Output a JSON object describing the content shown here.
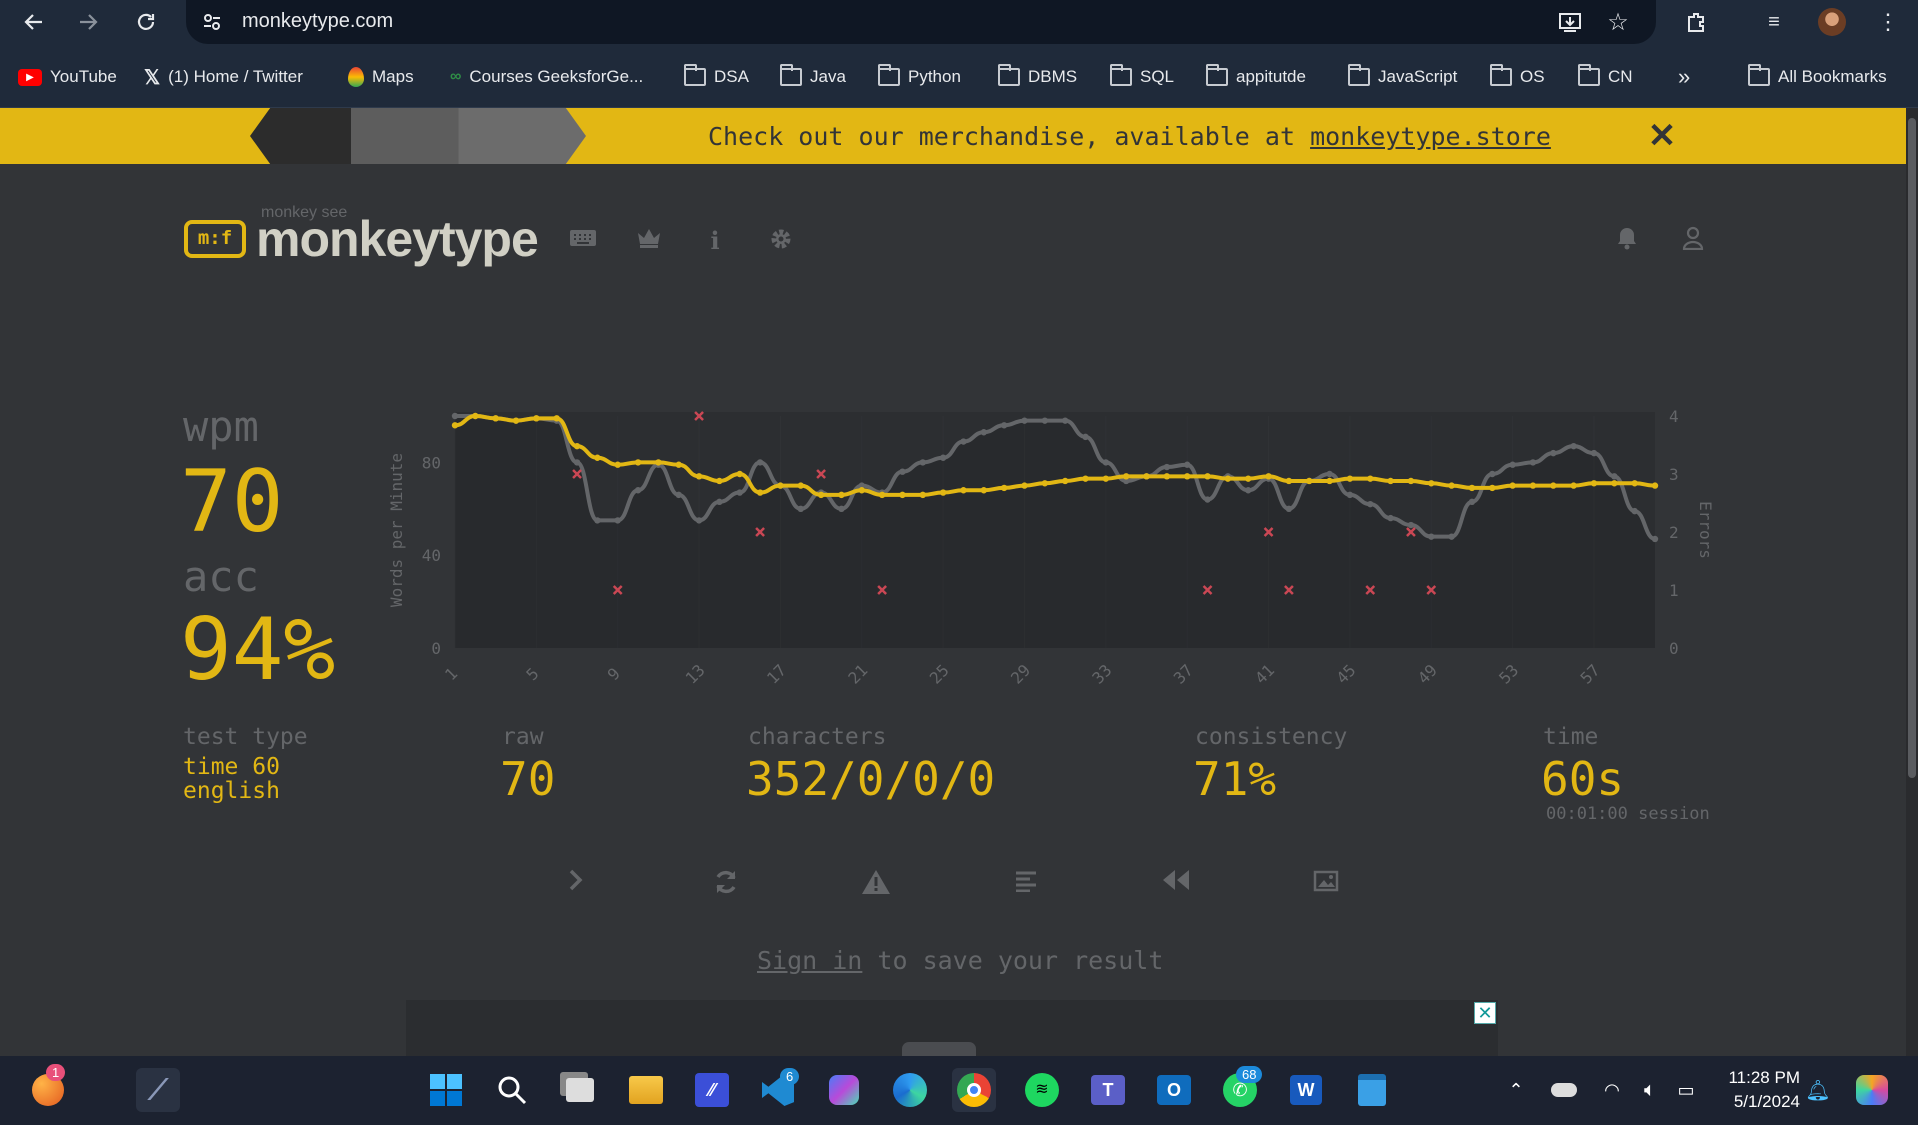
{
  "browser": {
    "url": "monkeytype.com",
    "bookmarks": [
      {
        "label": "YouTube",
        "icon": "youtube-icon"
      },
      {
        "label": "(1) Home / Twitter",
        "icon": "x-icon"
      },
      {
        "label": "Maps",
        "icon": "maps-icon"
      },
      {
        "label": "Courses GeeksforGe...",
        "icon": "geeksforgeeks-icon"
      },
      {
        "label": "DSA",
        "icon": "folder-icon"
      },
      {
        "label": "Java",
        "icon": "folder-icon"
      },
      {
        "label": "Python",
        "icon": "folder-icon"
      },
      {
        "label": "DBMS",
        "icon": "folder-icon"
      },
      {
        "label": "SQL",
        "icon": "folder-icon"
      },
      {
        "label": "appitutde",
        "icon": "folder-icon"
      },
      {
        "label": "JavaScript",
        "icon": "folder-icon"
      },
      {
        "label": "OS",
        "icon": "folder-icon"
      },
      {
        "label": "CN",
        "icon": "folder-icon"
      }
    ],
    "all_bookmarks": "All Bookmarks",
    "more_glyph": "»"
  },
  "banner": {
    "text": "Check out our merchandise, available at ",
    "link": "monkeytype.store",
    "close": "✕"
  },
  "header": {
    "logo_small": "monkey see",
    "logo": "monkeytype",
    "logo_icon_text": "m:f"
  },
  "results": {
    "wpm_label": "wpm",
    "wpm": "70",
    "acc_label": "acc",
    "acc": "94%",
    "test_type_label": "test type",
    "test_type_1": "time 60",
    "test_type_2": "english",
    "raw_label": "raw",
    "raw": "70",
    "characters_label": "characters",
    "characters": "352/0/0/0",
    "consistency_label": "consistency",
    "consistency": "71%",
    "time_label": "time",
    "time": "60s",
    "session": "00:01:00 session"
  },
  "footer": {
    "signin_link": "Sign in",
    "signin_rest": " to save your result"
  },
  "taskbar": {
    "time": "11:28 PM",
    "date": "5/1/2024",
    "badges": {
      "edge_notif": "1",
      "vscode": "6",
      "whatsapp": "68"
    }
  },
  "colors": {
    "accent": "#e2b714",
    "bg": "#323437",
    "sub": "#646669",
    "raw_line": "#646669",
    "error": "#ca4754"
  },
  "chart_data": {
    "type": "line",
    "ylabel": "Words per Minute",
    "y2label": "Errors",
    "ylim": [
      0,
      100
    ],
    "y2lim": [
      0,
      4
    ],
    "yticks": [
      "0",
      "40",
      "80"
    ],
    "y2ticks": [
      "0",
      "1",
      "2",
      "3",
      "4"
    ],
    "xticks": [
      "1",
      "5",
      "9",
      "13",
      "17",
      "21",
      "25",
      "29",
      "33",
      "37",
      "41",
      "45",
      "49",
      "53",
      "57"
    ],
    "x": [
      1,
      2,
      3,
      4,
      5,
      6,
      7,
      8,
      9,
      10,
      11,
      12,
      13,
      14,
      15,
      16,
      17,
      18,
      19,
      20,
      21,
      22,
      23,
      24,
      25,
      26,
      27,
      28,
      29,
      30,
      31,
      32,
      33,
      34,
      35,
      36,
      37,
      38,
      39,
      40,
      41,
      42,
      43,
      44,
      45,
      46,
      47,
      48,
      49,
      50,
      51,
      52,
      53,
      54,
      55,
      56,
      57,
      58,
      59,
      60
    ],
    "series": [
      {
        "values": [
          96,
          100,
          99,
          98,
          99,
          99,
          87,
          82,
          79,
          80,
          80,
          79,
          74,
          72,
          75,
          67,
          70,
          70,
          66,
          66,
          68,
          66,
          66,
          66,
          67,
          68,
          68,
          69,
          70,
          71,
          72,
          73,
          73,
          74,
          74,
          74,
          74,
          74,
          73,
          73,
          74,
          72,
          72,
          72,
          73,
          73,
          72,
          72,
          71,
          70,
          69,
          69,
          70,
          70,
          70,
          70,
          71,
          71,
          71,
          70
        ]
      },
      {
        "values": [
          100,
          100,
          99,
          98,
          99,
          98,
          80,
          55,
          55,
          68,
          79,
          66,
          55,
          63,
          67,
          80,
          70,
          60,
          67,
          60,
          70,
          67,
          76,
          80,
          82,
          89,
          93,
          96,
          98,
          98,
          98,
          91,
          80,
          72,
          74,
          78,
          79,
          64,
          74,
          68,
          73,
          60,
          72,
          75,
          66,
          62,
          56,
          53,
          48,
          48,
          63,
          75,
          79,
          80,
          84,
          87,
          84,
          74,
          59,
          47
        ]
      }
    ],
    "errors": [
      {
        "x": 7,
        "y": 3
      },
      {
        "x": 9,
        "y": 1
      },
      {
        "x": 13,
        "y": 4
      },
      {
        "x": 16,
        "y": 2
      },
      {
        "x": 19,
        "y": 3
      },
      {
        "x": 22,
        "y": 1
      },
      {
        "x": 38,
        "y": 1
      },
      {
        "x": 41,
        "y": 2
      },
      {
        "x": 42,
        "y": 1
      },
      {
        "x": 46,
        "y": 1
      },
      {
        "x": 48,
        "y": 2
      },
      {
        "x": 49,
        "y": 1
      }
    ]
  }
}
